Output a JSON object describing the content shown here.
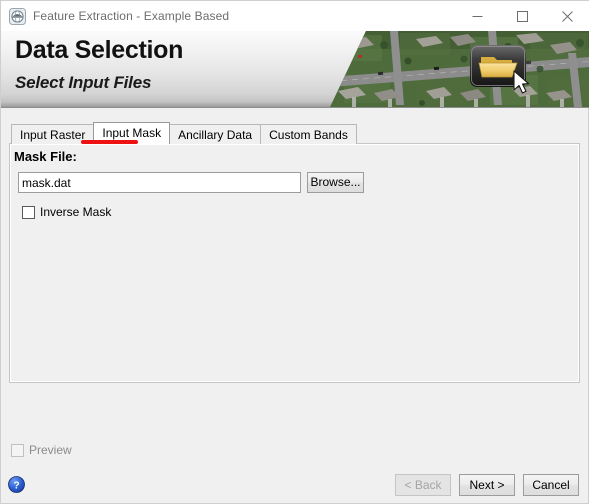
{
  "window": {
    "title": "Feature Extraction - Example Based",
    "icon": "app-globe-icon",
    "controls": {
      "minimize": "minimize-icon",
      "maximize": "maximize-icon",
      "close": "close-icon"
    }
  },
  "banner": {
    "title": "Data Selection",
    "subtitle": "Select Input Files",
    "image_description": "aerial-neighborhood-photo",
    "overlay_icon": "open-folder-icon",
    "cursor_icon": "mouse-pointer-icon"
  },
  "tabs": [
    {
      "label": "Input Raster",
      "active": false
    },
    {
      "label": "Input Mask",
      "active": true
    },
    {
      "label": "Ancillary Data",
      "active": false
    },
    {
      "label": "Custom Bands",
      "active": false
    }
  ],
  "annotation": {
    "type": "red-underline",
    "target": "Input Mask",
    "color": "#ee1111"
  },
  "panel": {
    "mask_file_label": "Mask File:",
    "mask_file_value": "mask.dat",
    "mask_file_placeholder": "",
    "browse_label": "Browse...",
    "inverse_mask_label": "Inverse Mask",
    "inverse_mask_checked": false
  },
  "footer": {
    "preview_label": "Preview",
    "preview_checked": false,
    "preview_enabled": false,
    "help_icon": "help-question-icon",
    "back_label": "< Back",
    "back_enabled": false,
    "next_label": "Next >",
    "cancel_label": "Cancel"
  },
  "colors": {
    "annotation_red": "#ee1111",
    "help_blue": "#2b5fd9",
    "window_background": "#f0f0f0",
    "title_text": "#6d6d6d"
  }
}
